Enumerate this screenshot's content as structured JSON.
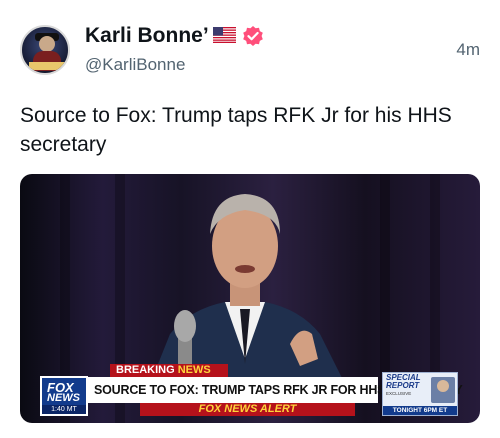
{
  "author": {
    "display_name": "Karli Bonne’",
    "handle": "@KarliBonne",
    "flag_icon": "us-flag-icon",
    "verified_icon": "verified-badge-icon",
    "verified_color": "#ff4f7b"
  },
  "post": {
    "timestamp": "4m",
    "text": "Source to Fox: Trump taps RFK Jr for his HHS secretary"
  },
  "media": {
    "breaking_label": "BREAKING",
    "news_label": "NEWS",
    "network_top": "FOX",
    "network_bottom": "NEWS",
    "time_shown": "1:40 MT",
    "headline": "SOURCE TO FOX: TRUMP TAPS RFK JR FOR HHS SECRETARY",
    "alert": "FOX NEWS ALERT",
    "special_title": "SPECIAL REPORT",
    "special_exclusive": "EXCLUSIVE",
    "special_bottom": "TONIGHT 6PM ET"
  },
  "colors": {
    "fox_red": "#b5121b",
    "fox_blue": "#123b8c",
    "alert_yellow": "#ffd43b"
  }
}
